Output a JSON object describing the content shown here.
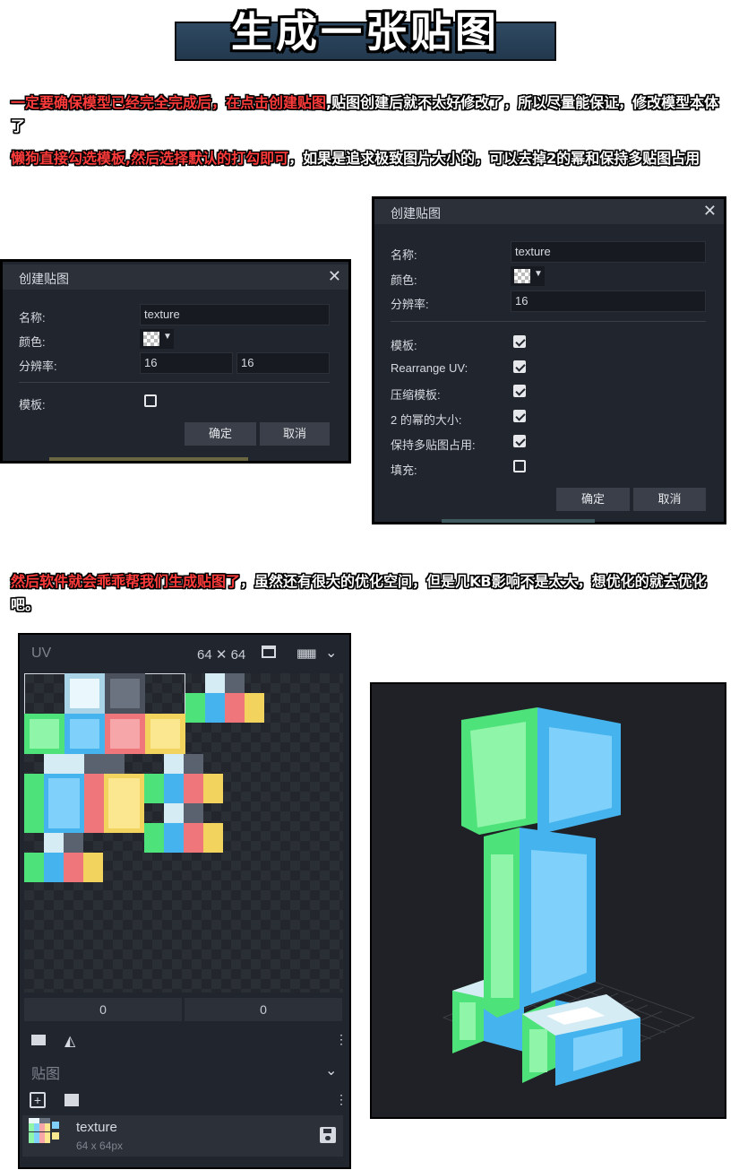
{
  "title": "生成一张贴图",
  "paragraph1": {
    "red_part": "一定要确保模型已经完全完成后，在点击创建贴图",
    "rest": ",贴图创建后就不太好修改了，所以尽量能保证，修改模型本体了"
  },
  "paragraph2": {
    "red_part": "懒狗直接勾选模板,然后选择默认的打勾即可",
    "rest": "，如果是追求极致图片大小的，可以去掉2的幂和保持多贴图占用"
  },
  "paragraph3": {
    "red_part": "然后软件就会乖乖帮我们生成贴图了",
    "rest": "，虽然还有很大的优化空间，但是几KB影响不是太大，想优化的就去优化吧。"
  },
  "dialog_small": {
    "title": "创建贴图",
    "close": "✕",
    "name_label": "名称:",
    "name_value": "texture",
    "color_label": "颜色:",
    "resolution_label": "分辨率:",
    "res_w": "16",
    "res_h": "16",
    "template_label": "模板:",
    "confirm": "确定",
    "cancel": "取消"
  },
  "dialog_large": {
    "title": "创建贴图",
    "close": "✕",
    "name_label": "名称:",
    "name_value": "texture",
    "color_label": "颜色:",
    "resolution_label": "分辨率:",
    "res": "16",
    "options": [
      {
        "label": "模板:",
        "checked": true
      },
      {
        "label": "Rearrange UV:",
        "checked": true
      },
      {
        "label": "压缩模板:",
        "checked": true
      },
      {
        "label": "2 的幂的大小:",
        "checked": true
      },
      {
        "label": "保持多贴图占用:",
        "checked": true
      },
      {
        "label": "填充:",
        "checked": false
      }
    ],
    "confirm": "确定",
    "cancel": "取消"
  },
  "uv_panel": {
    "header": "UV",
    "size": "64 ✕ 64",
    "field_x": "0",
    "field_y": "0",
    "textures_header": "贴图",
    "texture_name": "texture",
    "texture_size": "64 x 64px"
  },
  "colors": {
    "green": "#7ff39a",
    "blue": "#6cc8f6",
    "red": "#f49a9c",
    "yellow": "#f7e07c",
    "white": "#e8f6fc",
    "gray": "#5c6470"
  }
}
